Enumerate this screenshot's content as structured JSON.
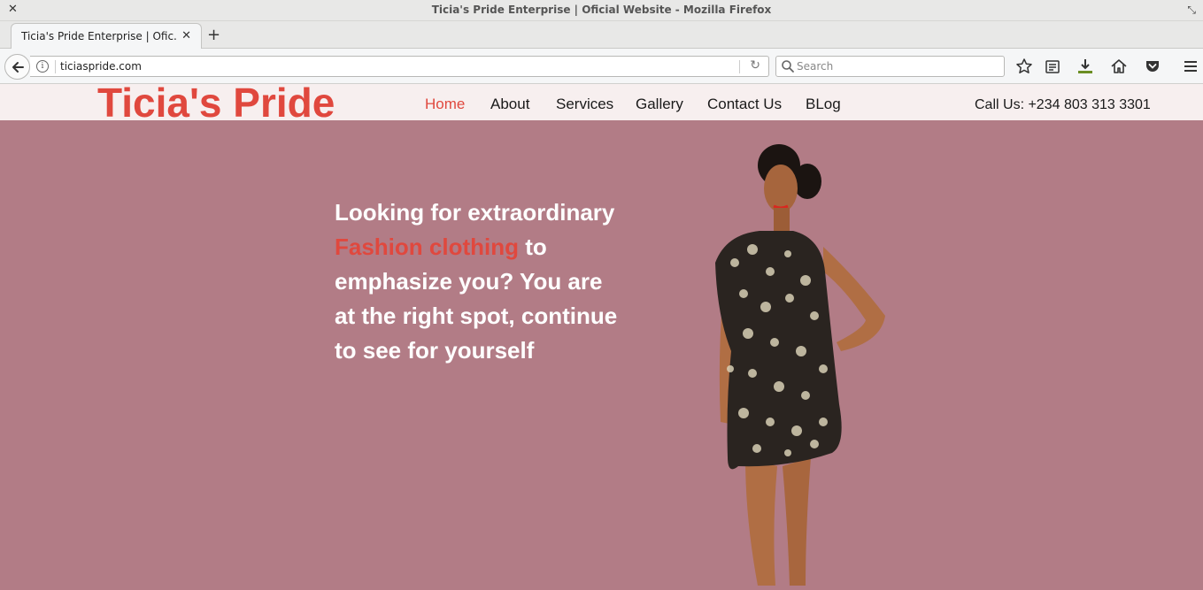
{
  "window": {
    "title": "Ticia's Pride Enterprise | Oficial Website - Mozilla Firefox"
  },
  "tabs": [
    {
      "label": "Ticia's Pride Enterprise | Ofic..."
    }
  ],
  "navbar": {
    "url": "ticiaspride.com",
    "search_placeholder": "Search"
  },
  "site": {
    "logo": "Ticia's Pride",
    "nav": [
      "Home",
      "About",
      "Services",
      "Gallery",
      "Contact Us",
      "BLog"
    ],
    "active_nav": "Home",
    "phone": "Call Us: +234 803 313 3301",
    "hero": {
      "before": "Looking for extraordinary",
      "highlight": "Fashion clothing",
      "after": "to emphasize you? You are at the right spot, continue to see for yourself"
    }
  },
  "colors": {
    "accent": "#e0483e",
    "hero_bg": "#b27c86",
    "header_bg": "#f7efef"
  }
}
